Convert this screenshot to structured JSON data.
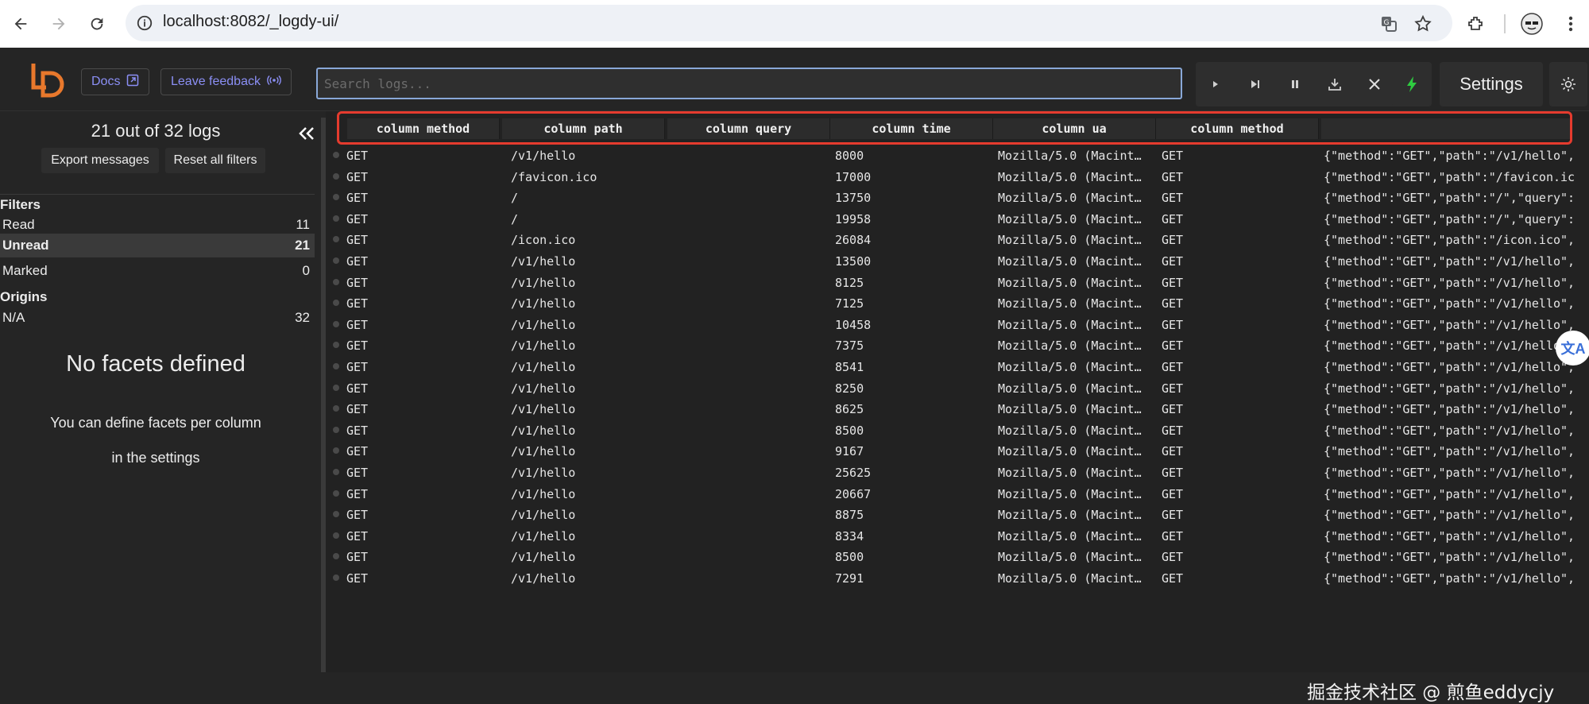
{
  "browser": {
    "url": "localhost:8082/_logdy-ui/"
  },
  "header": {
    "docs_label": "Docs",
    "feedback_label": "Leave feedback",
    "search_placeholder": "Search logs...",
    "settings_label": "Settings",
    "accent": "#8b8ff5",
    "logo_color": "#e8782c"
  },
  "sidebar": {
    "log_count": "21 out of 32 logs",
    "export_label": "Export messages",
    "reset_label": "Reset all filters",
    "filters_title": "Filters",
    "filters": [
      {
        "label": "Read",
        "count": "11"
      },
      {
        "label": "Unread",
        "count": "21"
      },
      {
        "label": "Marked",
        "count": "0"
      }
    ],
    "origins_title": "Origins",
    "origins": [
      {
        "label": "N/A",
        "count": "32"
      }
    ],
    "no_facets_title": "No facets defined",
    "no_facets_text": "You can define facets per column in the settings"
  },
  "table": {
    "columns": [
      "column method",
      "column path",
      "column query",
      "column time",
      "column ua",
      "column method"
    ],
    "rows": [
      {
        "method": "GET",
        "path": "/v1/hello",
        "query": "",
        "time": "8000",
        "ua": "Mozilla/5.0 (Macint…",
        "method2": "GET",
        "raw": "{\"method\":\"GET\",\"path\":\"/v1/hello\","
      },
      {
        "method": "GET",
        "path": "/favicon.ico",
        "query": "",
        "time": "17000",
        "ua": "Mozilla/5.0 (Macint…",
        "method2": "GET",
        "raw": "{\"method\":\"GET\",\"path\":\"/favicon.ic"
      },
      {
        "method": "GET",
        "path": "/",
        "query": "",
        "time": "13750",
        "ua": "Mozilla/5.0 (Macint…",
        "method2": "GET",
        "raw": "{\"method\":\"GET\",\"path\":\"/\",\"query\":"
      },
      {
        "method": "GET",
        "path": "/",
        "query": "",
        "time": "19958",
        "ua": "Mozilla/5.0 (Macint…",
        "method2": "GET",
        "raw": "{\"method\":\"GET\",\"path\":\"/\",\"query\":"
      },
      {
        "method": "GET",
        "path": "/icon.ico",
        "query": "",
        "time": "26084",
        "ua": "Mozilla/5.0 (Macint…",
        "method2": "GET",
        "raw": "{\"method\":\"GET\",\"path\":\"/icon.ico\","
      },
      {
        "method": "GET",
        "path": "/v1/hello",
        "query": "",
        "time": "13500",
        "ua": "Mozilla/5.0 (Macint…",
        "method2": "GET",
        "raw": "{\"method\":\"GET\",\"path\":\"/v1/hello\","
      },
      {
        "method": "GET",
        "path": "/v1/hello",
        "query": "",
        "time": "8125",
        "ua": "Mozilla/5.0 (Macint…",
        "method2": "GET",
        "raw": "{\"method\":\"GET\",\"path\":\"/v1/hello\","
      },
      {
        "method": "GET",
        "path": "/v1/hello",
        "query": "",
        "time": "7125",
        "ua": "Mozilla/5.0 (Macint…",
        "method2": "GET",
        "raw": "{\"method\":\"GET\",\"path\":\"/v1/hello\","
      },
      {
        "method": "GET",
        "path": "/v1/hello",
        "query": "",
        "time": "10458",
        "ua": "Mozilla/5.0 (Macint…",
        "method2": "GET",
        "raw": "{\"method\":\"GET\",\"path\":\"/v1/hello\","
      },
      {
        "method": "GET",
        "path": "/v1/hello",
        "query": "",
        "time": "7375",
        "ua": "Mozilla/5.0 (Macint…",
        "method2": "GET",
        "raw": "{\"method\":\"GET\",\"path\":\"/v1/hello\","
      },
      {
        "method": "GET",
        "path": "/v1/hello",
        "query": "",
        "time": "8541",
        "ua": "Mozilla/5.0 (Macint…",
        "method2": "GET",
        "raw": "{\"method\":\"GET\",\"path\":\"/v1/hello\","
      },
      {
        "method": "GET",
        "path": "/v1/hello",
        "query": "",
        "time": "8250",
        "ua": "Mozilla/5.0 (Macint…",
        "method2": "GET",
        "raw": "{\"method\":\"GET\",\"path\":\"/v1/hello\","
      },
      {
        "method": "GET",
        "path": "/v1/hello",
        "query": "",
        "time": "8625",
        "ua": "Mozilla/5.0 (Macint…",
        "method2": "GET",
        "raw": "{\"method\":\"GET\",\"path\":\"/v1/hello\","
      },
      {
        "method": "GET",
        "path": "/v1/hello",
        "query": "",
        "time": "8500",
        "ua": "Mozilla/5.0 (Macint…",
        "method2": "GET",
        "raw": "{\"method\":\"GET\",\"path\":\"/v1/hello\","
      },
      {
        "method": "GET",
        "path": "/v1/hello",
        "query": "",
        "time": "9167",
        "ua": "Mozilla/5.0 (Macint…",
        "method2": "GET",
        "raw": "{\"method\":\"GET\",\"path\":\"/v1/hello\","
      },
      {
        "method": "GET",
        "path": "/v1/hello",
        "query": "",
        "time": "25625",
        "ua": "Mozilla/5.0 (Macint…",
        "method2": "GET",
        "raw": "{\"method\":\"GET\",\"path\":\"/v1/hello\","
      },
      {
        "method": "GET",
        "path": "/v1/hello",
        "query": "",
        "time": "20667",
        "ua": "Mozilla/5.0 (Macint…",
        "method2": "GET",
        "raw": "{\"method\":\"GET\",\"path\":\"/v1/hello\","
      },
      {
        "method": "GET",
        "path": "/v1/hello",
        "query": "",
        "time": "8875",
        "ua": "Mozilla/5.0 (Macint…",
        "method2": "GET",
        "raw": "{\"method\":\"GET\",\"path\":\"/v1/hello\","
      },
      {
        "method": "GET",
        "path": "/v1/hello",
        "query": "",
        "time": "8334",
        "ua": "Mozilla/5.0 (Macint…",
        "method2": "GET",
        "raw": "{\"method\":\"GET\",\"path\":\"/v1/hello\","
      },
      {
        "method": "GET",
        "path": "/v1/hello",
        "query": "",
        "time": "8500",
        "ua": "Mozilla/5.0 (Macint…",
        "method2": "GET",
        "raw": "{\"method\":\"GET\",\"path\":\"/v1/hello\","
      },
      {
        "method": "GET",
        "path": "/v1/hello",
        "query": "",
        "time": "7291",
        "ua": "Mozilla/5.0 (Macint…",
        "method2": "GET",
        "raw": "{\"method\":\"GET\",\"path\":\"/v1/hello\","
      }
    ]
  },
  "watermark": "掘金技术社区 @ 煎鱼eddycjy",
  "translate_glyph": "文A"
}
